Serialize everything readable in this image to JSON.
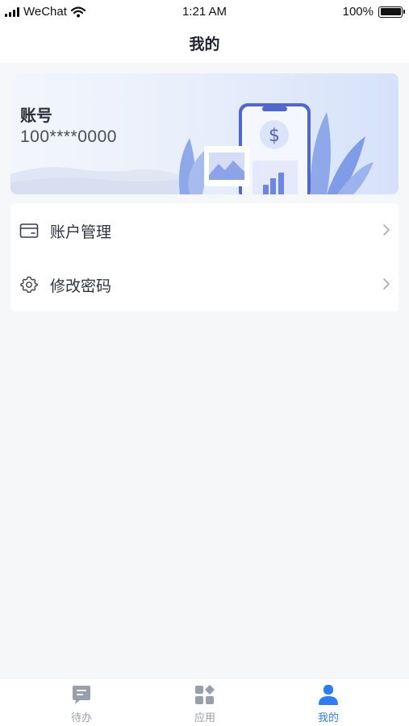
{
  "status_bar": {
    "carrier": "WeChat",
    "time": "1:21 AM",
    "battery": "100%"
  },
  "header": {
    "title": "我的"
  },
  "account": {
    "label": "账号",
    "number": "100****0000",
    "illustration_icon": "dollar-phone-illustration"
  },
  "menu": {
    "items": [
      {
        "label": "账户管理",
        "icon": "card-icon"
      },
      {
        "label": "修改密码",
        "icon": "gear-icon"
      }
    ]
  },
  "tabs": [
    {
      "label": "待办",
      "icon": "message-icon",
      "active": false
    },
    {
      "label": "应用",
      "icon": "apps-grid-icon",
      "active": false
    },
    {
      "label": "我的",
      "icon": "person-icon",
      "active": true
    }
  ],
  "colors": {
    "accent": "#2e7cf6",
    "inactive": "#9aa0ab",
    "background": "#f6f7f9"
  }
}
